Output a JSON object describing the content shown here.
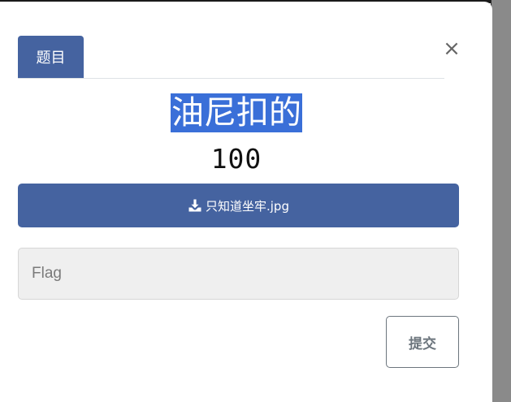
{
  "modal": {
    "tab_label": "题目",
    "close_symbol": "×",
    "challenge_name": "油尼扣的",
    "points": "100",
    "download_file": "只知道坐牢.jpg",
    "download_icon": "download-icon",
    "flag_placeholder": "Flag",
    "flag_value": "",
    "submit_label": "提交"
  },
  "colors": {
    "primary": "#4563a0",
    "selection": "#3a6fd8",
    "input_bg": "#efefef",
    "secondary": "#6c757d"
  }
}
